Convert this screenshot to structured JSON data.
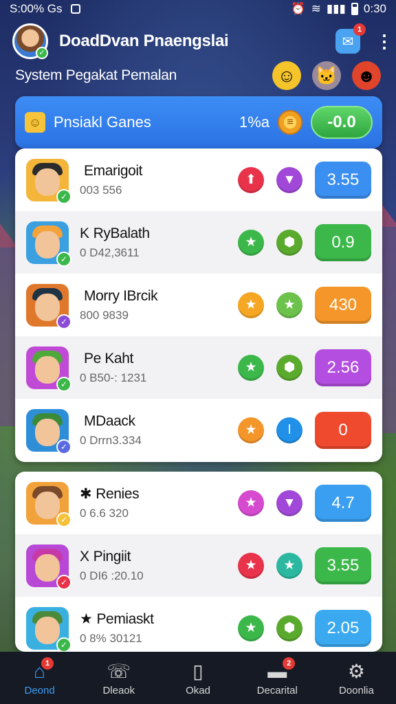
{
  "status": {
    "left_text": "S:00% Gs",
    "time": "0:30"
  },
  "header": {
    "title": "DoadDvan Pnaengslai",
    "mail_badge": "1",
    "subtitle": "System Pegakat Pemalan"
  },
  "banner": {
    "title": "Pnsiakl Ganes",
    "count": "1%a",
    "button": "-0.0"
  },
  "games": [
    {
      "name": "Emarigoit",
      "prefix": "",
      "meta": "003 556",
      "score": "3.55",
      "score_color": "#3a8ff0",
      "action1_color": "#e8334a",
      "action1_icon": "arrow-up-icon",
      "action2_color": "#a148d8",
      "action2_icon": "chevron-down-icon",
      "avatar_bg": "#f3b53a",
      "hat": "#2b2b2b",
      "check_color": "#3cb84a"
    },
    {
      "name": "RyBalath",
      "prefix": "K",
      "meta": "0 D42,3611",
      "score": "0.9",
      "score_color": "#3cb84a",
      "action1_color": "#3cb84a",
      "action1_icon": "star-icon",
      "action2_color": "#5aaa2e",
      "action2_icon": "shield-icon",
      "avatar_bg": "#3aa0e0",
      "hat": "#f2a33a",
      "check_color": "#3cb84a"
    },
    {
      "name": "Morry IBrcik",
      "prefix": "",
      "meta": "800 9839",
      "score": "430",
      "score_color": "#f5962a",
      "action1_color": "#f5a623",
      "action1_icon": "star-icon",
      "action2_color": "#6cc24a",
      "action2_icon": "star-icon",
      "avatar_bg": "#e0782c",
      "hat": "#1e3344",
      "check_color": "#8a4bd6"
    },
    {
      "name": "Pe Kaht",
      "prefix": "",
      "meta": "0 B50-: 1231",
      "score": "2.56",
      "score_color": "#b44ee0",
      "action1_color": "#3cb84a",
      "action1_icon": "star-icon",
      "action2_color": "#5aaa2e",
      "action2_icon": "shield-icon",
      "avatar_bg": "#c04ad6",
      "hat": "#4fa83a",
      "check_color": "#3cb84a"
    },
    {
      "name": "MDaack",
      "prefix": "",
      "meta": "0 Drrn3.334",
      "score": "0",
      "score_color": "#f04a2e",
      "action1_color": "#f5962a",
      "action1_icon": "star-icon",
      "action2_color": "#2090e8",
      "action2_icon": "info-icon",
      "avatar_bg": "#2f8ed8",
      "hat": "#3a8a3a",
      "check_color": "#5a6ae0"
    },
    {
      "name": "Renies",
      "prefix": "✱",
      "meta": "0 6.6 320",
      "score": "4.7",
      "score_color": "#3a9ff0",
      "action1_color": "#d64ad0",
      "action1_icon": "star-icon",
      "action2_color": "#a148d8",
      "action2_icon": "chevron-down-icon",
      "avatar_bg": "#f2a23a",
      "hat": "#7a4a2a",
      "check_color": "#f5c23a"
    },
    {
      "name": "Pingiit",
      "prefix": "X",
      "meta": "0 DI6 :20.10",
      "score": "3.55",
      "score_color": "#3cb84a",
      "action1_color": "#e8334a",
      "action1_icon": "star-icon",
      "action2_color": "#2cb8a0",
      "action2_icon": "star-icon",
      "avatar_bg": "#b848d6",
      "hat": "#c63aa8",
      "check_color": "#e8334a"
    },
    {
      "name": "Pemiaskt",
      "prefix": "★",
      "meta": "0 8% 30121",
      "score": "2.05",
      "score_color": "#3aa9f0",
      "action1_color": "#3cb84a",
      "action1_icon": "star-icon",
      "action2_color": "#5aaa2e",
      "action2_icon": "shield-icon",
      "avatar_bg": "#3ab0e0",
      "hat": "#4a8a3a",
      "check_color": "#3cb84a"
    }
  ],
  "nav": [
    {
      "label": "Deond",
      "icon": "home-icon",
      "badge": "1",
      "active": true
    },
    {
      "label": "Dleaok",
      "icon": "phone-icon",
      "badge": "",
      "active": false
    },
    {
      "label": "Okad",
      "icon": "book-icon",
      "badge": "",
      "active": false
    },
    {
      "label": "Decarital",
      "icon": "chat-icon",
      "badge": "2",
      "active": false
    },
    {
      "label": "Doonlia",
      "icon": "settings-icon",
      "badge": "",
      "active": false
    }
  ]
}
